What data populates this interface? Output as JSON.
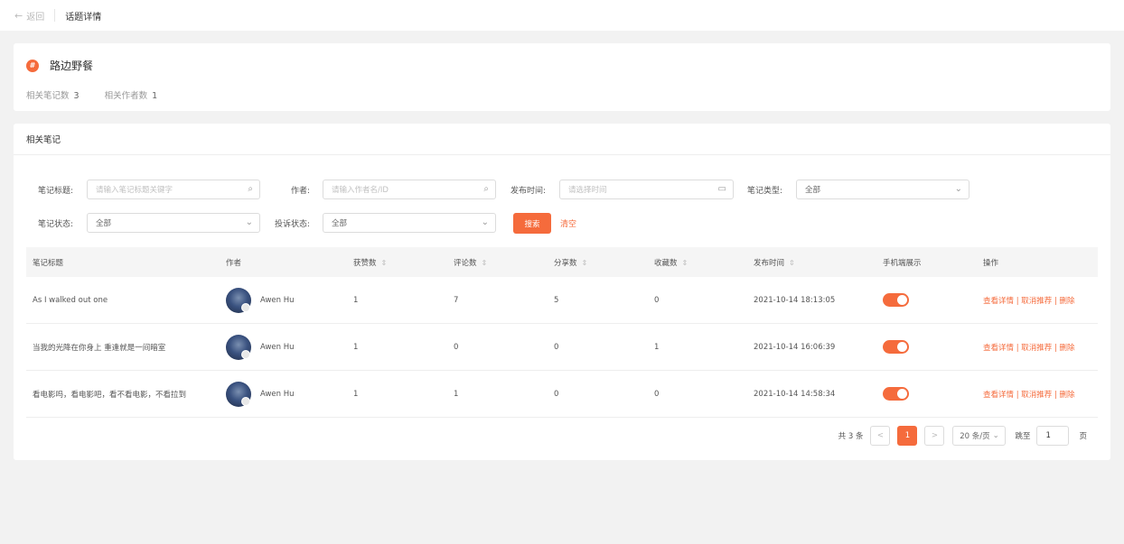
{
  "header": {
    "back_label": "返回",
    "breadcrumb": "话题详情"
  },
  "topic": {
    "icon": "#",
    "name": "路边野餐",
    "note_count_label": "相关笔记数",
    "note_count": "3",
    "author_count_label": "相关作者数",
    "author_count": "1"
  },
  "notes_section": {
    "title": "相关笔记"
  },
  "filters": {
    "title_label": "笔记标题:",
    "title_placeholder": "请输入笔记标题关键字",
    "author_label": "作者:",
    "author_placeholder": "请输入作者名/ID",
    "time_label": "发布时间:",
    "time_placeholder": "请选择时间",
    "type_label": "笔记类型:",
    "type_value": "全部",
    "status_label": "笔记状态:",
    "status_value": "全部",
    "complaint_label": "投诉状态:",
    "complaint_value": "全部",
    "search_button": "搜索",
    "clear_button": "清空"
  },
  "table": {
    "columns": [
      "笔记标题",
      "作者",
      "获赞数",
      "评论数",
      "分享数",
      "收藏数",
      "发布时间",
      "手机端展示",
      "操作"
    ],
    "rows": [
      {
        "title": "As I walked out one",
        "author": "Awen Hu",
        "likes": "1",
        "comments": "7",
        "shares": "5",
        "favorites": "0",
        "time": "2021-10-14 18:13:05",
        "ops": "查看详情 | 取消推荐 | 删除"
      },
      {
        "title": "当我的光降在你身上 重逢就是一间暗室",
        "author": "Awen Hu",
        "likes": "1",
        "comments": "0",
        "shares": "0",
        "favorites": "1",
        "time": "2021-10-14 16:06:39",
        "ops": "查看详情 | 取消推荐 | 删除"
      },
      {
        "title": "看电影吗，看电影吧，看不看电影，不看拉到",
        "author": "Awen Hu",
        "likes": "1",
        "comments": "1",
        "shares": "0",
        "favorites": "0",
        "time": "2021-10-14 14:58:34",
        "ops": "查看详情 | 取消推荐 | 删除"
      }
    ]
  },
  "pagination": {
    "total": "共 3 条",
    "prev": "<",
    "current_page": "1",
    "next": ">",
    "page_size": "20 条/页",
    "jump_label": "跳至",
    "jump_value": "1",
    "page_unit": "页"
  },
  "colors": {
    "accent": "#f56b3c",
    "background": "#f2f2f2"
  }
}
